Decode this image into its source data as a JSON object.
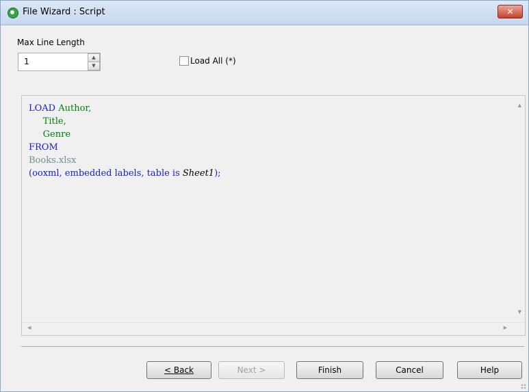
{
  "window": {
    "title": "File Wizard : Script",
    "close_glyph": "✕",
    "app_icon": "qlik-logo-icon"
  },
  "options": {
    "max_line_label": "Max Line Length",
    "max_line_value": "1",
    "load_all_label": "Load All (*)",
    "load_all_checked": false
  },
  "script": {
    "lines": [
      {
        "kw": "LOAD",
        "field": "Author,"
      },
      {
        "indent": "     ",
        "field": "Title,"
      },
      {
        "indent": "     ",
        "field": "Genre"
      },
      {
        "kw": "FROM"
      },
      {
        "file": "Books.xlsx"
      },
      {
        "pre": "(ooxml, embedded labels, table is ",
        "sheet": "Sheet1",
        "post": ");"
      }
    ]
  },
  "buttons": {
    "back": "< Back",
    "next": "Next >",
    "finish": "Finish",
    "cancel": "Cancel",
    "help": "Help"
  },
  "colors": {
    "keyword": "#1a1ad0",
    "field": "#00800a",
    "file": "#6f8e8e"
  }
}
